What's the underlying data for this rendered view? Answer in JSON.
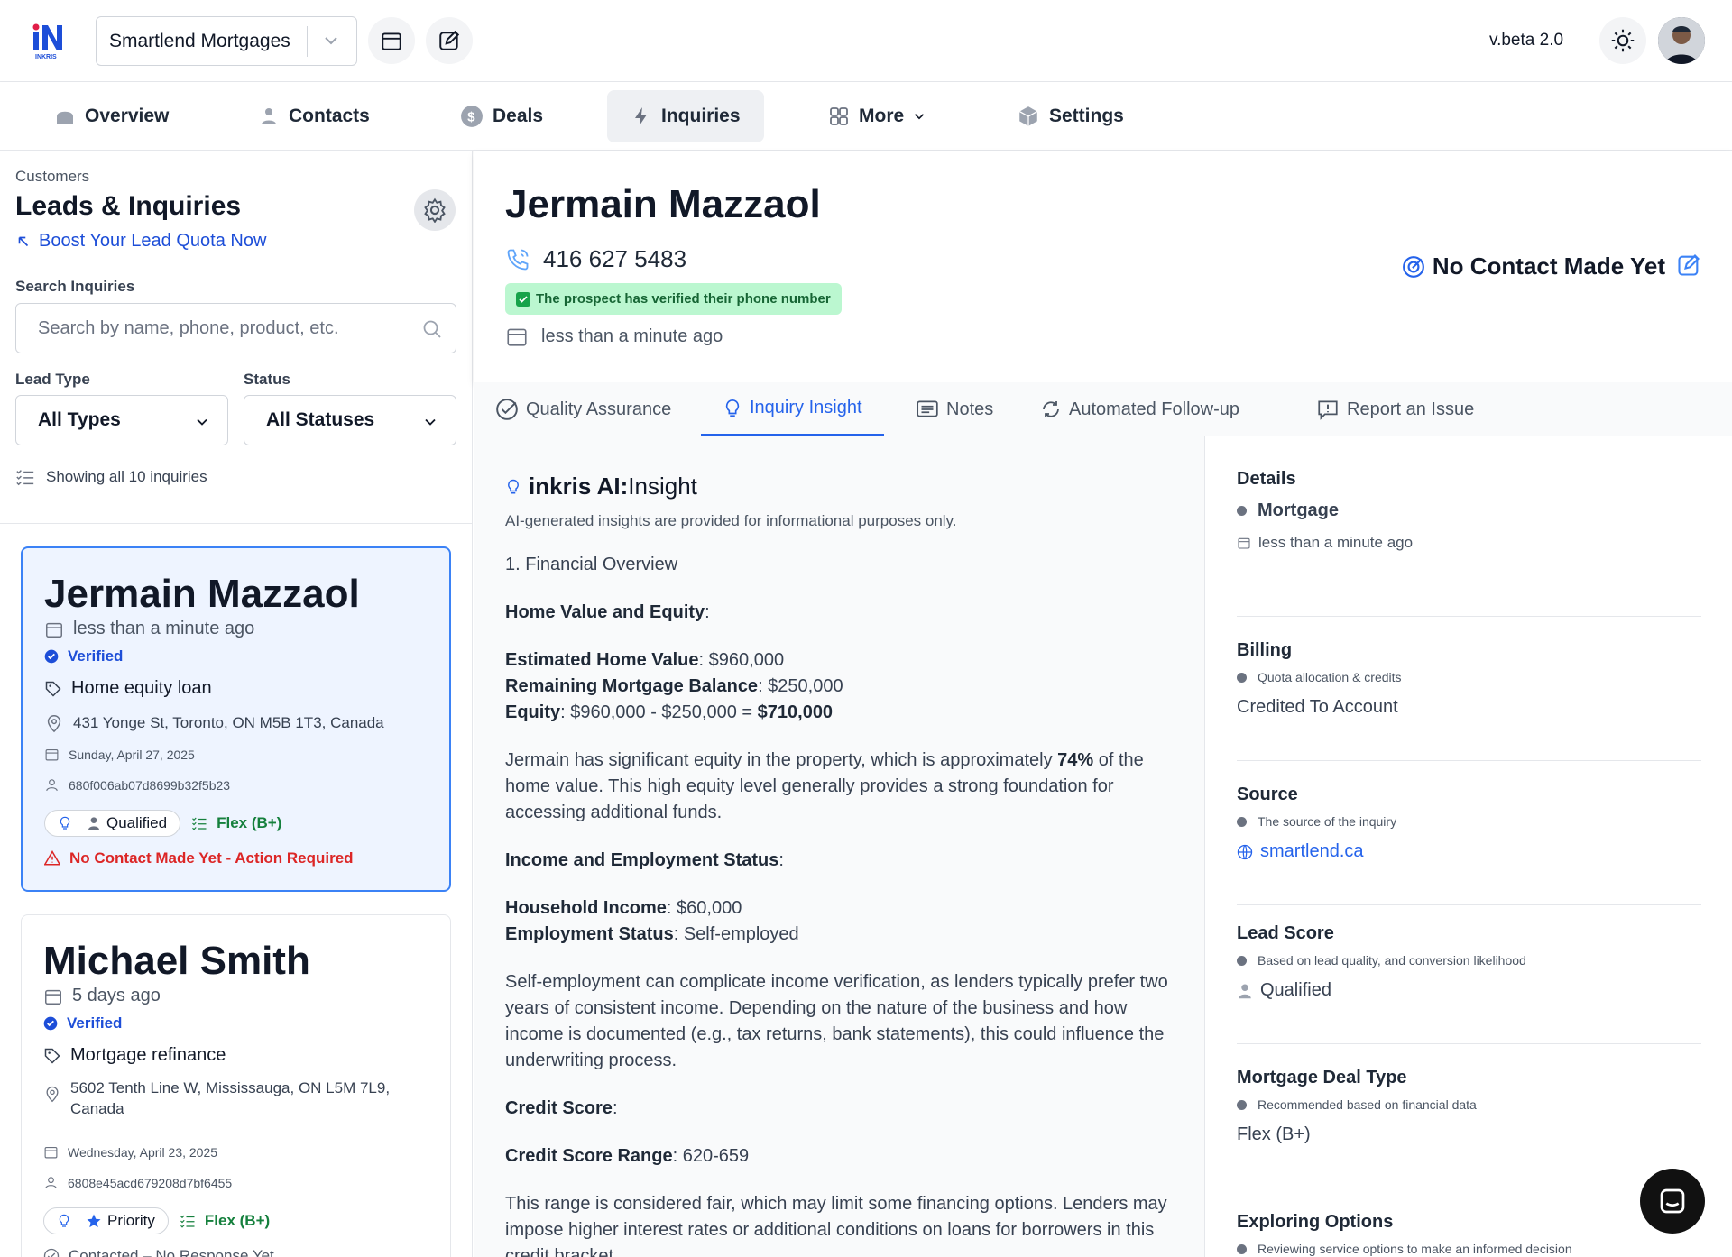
{
  "app": {
    "logo_text": "iN",
    "logo_sub": "INKRIS",
    "workspace": "Smartlend Mortgages",
    "version": "v.beta 2.0"
  },
  "nav": {
    "overview": "Overview",
    "contacts": "Contacts",
    "deals": "Deals",
    "inquiries": "Inquiries",
    "more": "More",
    "settings": "Settings"
  },
  "sidebar": {
    "breadcrumb": "Customers",
    "title": "Leads & Inquiries",
    "boost": "Boost Your Lead Quota Now",
    "search_label": "Search Inquiries",
    "search_placeholder": "Search by name, phone, product, etc.",
    "lead_type_label": "Lead Type",
    "lead_type_value": "All Types",
    "status_label": "Status",
    "status_value": "All Statuses",
    "showing": "Showing all 10 inquiries"
  },
  "cards": [
    {
      "name": "Jermain Mazzaol",
      "time": "less than a minute ago",
      "verified": "Verified",
      "product": "Home equity loan",
      "address": "431 Yonge St, Toronto, ON M5B 1T3, Canada",
      "date": "Sunday, April 27, 2025",
      "id": "680f006ab07d8699b32f5b23",
      "tag": "Qualified",
      "deal": "Flex (B+)",
      "alert": "No Contact Made Yet - Action Required"
    },
    {
      "name": "Michael Smith",
      "time": "5 days ago",
      "verified": "Verified",
      "product": "Mortgage refinance",
      "address": "5602 Tenth Line W, Mississauga, ON L5M 7L9, Canada",
      "date": "Wednesday, April 23, 2025",
      "id": "6808e45acd679208d7bf6455",
      "tag": "Priority",
      "deal": "Flex (B+)",
      "alert": "Contacted – No Response Yet"
    }
  ],
  "header": {
    "name": "Jermain Mazzaol",
    "phone": "416 627 5483",
    "verified_badge": "The prospect has verified their phone number",
    "time": "less than a minute ago",
    "status": "No Contact Made Yet"
  },
  "tabs": [
    "Quality Assurance",
    "Inquiry Insight",
    "Notes",
    "Automated Follow-up",
    "Report an Issue"
  ],
  "insight": {
    "title_bold": "inkris AI:",
    "title_rest": " Insight",
    "disclaimer": "AI-generated insights are provided for informational purposes only.",
    "section1": "1. Financial Overview",
    "h_home": "Home Value and Equity",
    "l_est": "Estimated Home Value",
    "v_est": ": $960,000",
    "l_rem": "Remaining Mortgage Balance",
    "v_rem": ": $250,000",
    "l_eq": "Equity",
    "v_eq": ": $960,000 - $250,000 = ",
    "v_eq_total": "$710,000",
    "p_equity_a": "Jermain has significant equity in the property, which is approximately ",
    "p_equity_pct": "74%",
    "p_equity_b": " of the home value. This high equity level generally provides a strong foundation for accessing additional funds.",
    "h_income": "Income and Employment Status",
    "l_hh": "Household Income",
    "v_hh": ": $60,000",
    "l_emp": "Employment Status",
    "v_emp": ": Self-employed",
    "p_self": "Self-employment can complicate income verification, as lenders typically prefer two years of consistent income. Depending on the nature of the business and how income is documented (e.g., tax returns, bank statements), this could influence the underwriting process.",
    "h_credit": "Credit Score",
    "l_range": "Credit Score Range",
    "v_range": ": 620-659",
    "p_range": "This range is considered fair, which may limit some financing options. Lenders may impose higher interest rates or additional conditions on loans for borrowers in this credit bracket."
  },
  "details": {
    "details_title": "Details",
    "details_type": "Mortgage",
    "details_time": "less than a minute ago",
    "billing_title": "Billing",
    "billing_sub": "Quota allocation & credits",
    "billing_val": "Credited To Account",
    "source_title": "Source",
    "source_sub": "The source of the inquiry",
    "source_val": "smartlend.ca",
    "score_title": "Lead Score",
    "score_sub": "Based on lead quality, and conversion likelihood",
    "score_val": "Qualified",
    "deal_title": "Mortgage Deal Type",
    "deal_sub": "Recommended based on financial data",
    "deal_val": "Flex (B+)",
    "explore_title": "Exploring Options",
    "explore_sub": "Reviewing service options to make an informed decision"
  }
}
